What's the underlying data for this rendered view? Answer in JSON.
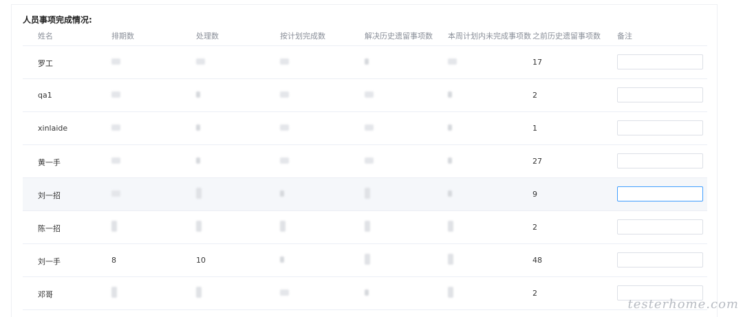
{
  "section_title": "人员事项完成情况:",
  "columns": [
    "姓名",
    "排期数",
    "处理数",
    "按计划完成数",
    "解决历史遗留事项数",
    "本周计划内未完成事项数",
    "之前历史遗留事项数",
    "备注"
  ],
  "rows": [
    {
      "name": "罗工",
      "scheduled": "",
      "handled": "",
      "on_plan": "",
      "resolved_legacy": "",
      "unfinished": "",
      "prior_legacy": "17",
      "remark": ""
    },
    {
      "name": "qa1",
      "scheduled": "",
      "handled": "",
      "on_plan": "",
      "resolved_legacy": "",
      "unfinished": "",
      "prior_legacy": "2",
      "remark": ""
    },
    {
      "name": "xinlaide",
      "scheduled": "",
      "handled": "",
      "on_plan": "",
      "resolved_legacy": "",
      "unfinished": "",
      "prior_legacy": "1",
      "remark": ""
    },
    {
      "name": "黄一手",
      "scheduled": "",
      "handled": "",
      "on_plan": "",
      "resolved_legacy": "",
      "unfinished": "",
      "prior_legacy": "27",
      "remark": ""
    },
    {
      "name": "刘一招",
      "scheduled": "",
      "handled": "",
      "on_plan": "",
      "resolved_legacy": "",
      "unfinished": "",
      "prior_legacy": "9",
      "remark": ""
    },
    {
      "name": "陈一招",
      "scheduled": "",
      "handled": "",
      "on_plan": "",
      "resolved_legacy": "",
      "unfinished": "",
      "prior_legacy": "2",
      "remark": ""
    },
    {
      "name": "刘一手",
      "scheduled": "8",
      "handled": "10",
      "on_plan": "",
      "resolved_legacy": "",
      "unfinished": "",
      "prior_legacy": "48",
      "remark": ""
    },
    {
      "name": "邓哥",
      "scheduled": "",
      "handled": "",
      "on_plan": "",
      "resolved_legacy": "",
      "unfinished": "",
      "prior_legacy": "2",
      "remark": ""
    }
  ],
  "focused_row": 4,
  "hover_row": 4,
  "watermark": "testerhome.com"
}
